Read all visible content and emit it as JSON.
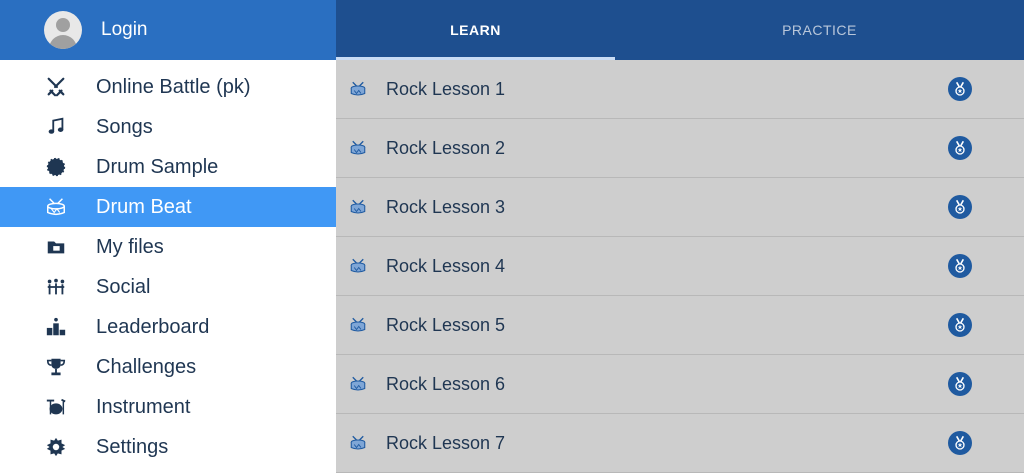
{
  "sidebar": {
    "login_label": "Login",
    "active_index": 3,
    "items": [
      {
        "label": "Online Battle (pk)",
        "icon": "swords-icon"
      },
      {
        "label": "Songs",
        "icon": "music-note-icon"
      },
      {
        "label": "Drum Sample",
        "icon": "cymbal-icon"
      },
      {
        "label": "Drum Beat",
        "icon": "drum-icon"
      },
      {
        "label": "My files",
        "icon": "folder-icon"
      },
      {
        "label": "Social",
        "icon": "social-icon"
      },
      {
        "label": "Leaderboard",
        "icon": "podium-icon"
      },
      {
        "label": "Challenges",
        "icon": "trophy-icon"
      },
      {
        "label": "Instrument",
        "icon": "drum-kit-icon"
      },
      {
        "label": "Settings",
        "icon": "gear-icon"
      }
    ]
  },
  "tabs": [
    {
      "label": "LEARN",
      "active": true
    },
    {
      "label": "PRACTICE",
      "active": false
    }
  ],
  "lessons": [
    {
      "label": "Rock Lesson 1"
    },
    {
      "label": "Rock Lesson 2"
    },
    {
      "label": "Rock Lesson 3"
    },
    {
      "label": "Rock Lesson 4"
    },
    {
      "label": "Rock Lesson 5"
    },
    {
      "label": "Rock Lesson 6"
    },
    {
      "label": "Rock Lesson 7"
    }
  ],
  "colors": {
    "sidebar_header": "#2a6fc1",
    "active_item": "#4098f5",
    "tab_bar": "#1e4f8f",
    "medal": "#1f5aa0",
    "text_dark": "#1f3652"
  }
}
